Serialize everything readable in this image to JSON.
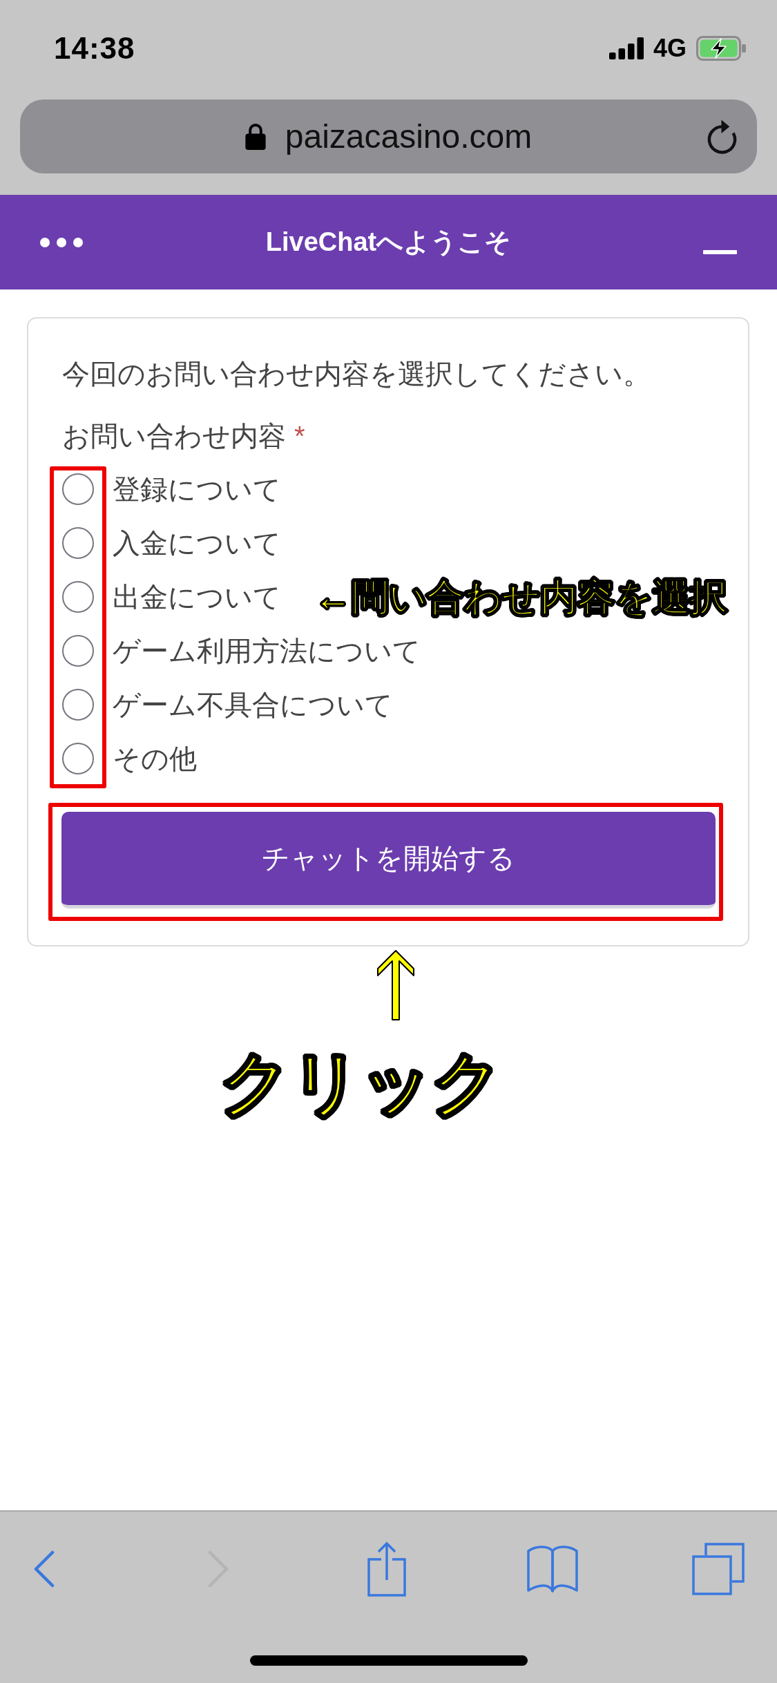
{
  "status_bar": {
    "time": "14:38",
    "network": "4G"
  },
  "address_bar": {
    "url": "paizacasino.com"
  },
  "chat_header": {
    "title": "LiveChatへようこそ"
  },
  "form": {
    "intro": "今回のお問い合わせ内容を選択してください。",
    "field": {
      "label": "お問い合わせ内容",
      "required_mark": "*",
      "options": [
        {
          "label": "登録について",
          "selected": false
        },
        {
          "label": "入金について",
          "selected": false
        },
        {
          "label": "出金について",
          "selected": false
        },
        {
          "label": "ゲーム利用方法について",
          "selected": false
        },
        {
          "label": "ゲーム不具合について",
          "selected": false
        },
        {
          "label": "その他",
          "selected": false
        }
      ]
    },
    "submit": "チャットを開始する"
  },
  "annotations": {
    "options_note": "←問い合わせ内容を選択",
    "button_note": "クリック"
  },
  "toolbar": [
    {
      "kind": "back",
      "disabled": false
    },
    {
      "kind": "forward",
      "disabled": true
    },
    {
      "kind": "share",
      "disabled": false
    },
    {
      "kind": "bookmarks",
      "disabled": false
    },
    {
      "kind": "tabs",
      "disabled": false
    }
  ]
}
